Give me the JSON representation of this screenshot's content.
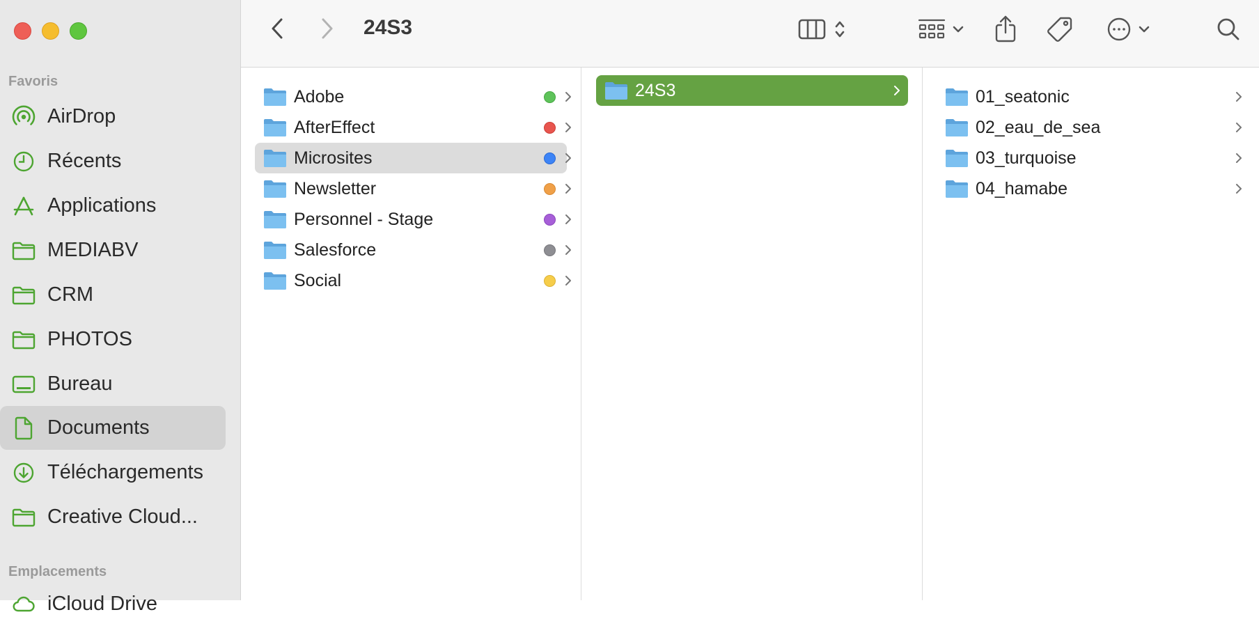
{
  "window": {
    "title": "24S3",
    "traffic_lights": [
      "close",
      "minimize",
      "zoom"
    ]
  },
  "sidebar": {
    "favorites_label": "Favoris",
    "locations_label": "Emplacements",
    "items": [
      {
        "label": "AirDrop",
        "icon": "airdrop-icon"
      },
      {
        "label": "Récents",
        "icon": "clock-icon"
      },
      {
        "label": "Applications",
        "icon": "applications-icon"
      },
      {
        "label": "MEDIABV",
        "icon": "folder-icon"
      },
      {
        "label": "CRM",
        "icon": "folder-icon"
      },
      {
        "label": "PHOTOS",
        "icon": "folder-icon"
      },
      {
        "label": "Bureau",
        "icon": "desktop-icon"
      },
      {
        "label": "Documents",
        "icon": "document-icon",
        "selected": true
      },
      {
        "label": "Téléchargements",
        "icon": "download-icon"
      },
      {
        "label": "Creative Cloud...",
        "icon": "folder-icon"
      }
    ],
    "partial_item": {
      "label": "iCloud Drive",
      "icon": "cloud-icon"
    }
  },
  "toolbar": {
    "back": "chevron-left-icon",
    "forward": "chevron-right-icon",
    "view": "column-view-icon",
    "group": "grid-group-icon",
    "share": "share-icon",
    "tags": "tag-icon",
    "more": "more-icon",
    "search": "search-icon"
  },
  "columns": {
    "first": [
      {
        "name": "Adobe",
        "tag": "#5ec35a"
      },
      {
        "name": "AfterEffect",
        "tag": "#e8554e"
      },
      {
        "name": "Microsites",
        "tag": "#3d84f6",
        "selected": true
      },
      {
        "name": "Newsletter",
        "tag": "#f0a048"
      },
      {
        "name": "Personnel - Stage",
        "tag": "#a75fd8"
      },
      {
        "name": "Salesforce",
        "tag": "#8e8e93"
      },
      {
        "name": "Social",
        "tag": "#f6cd4a"
      }
    ],
    "second": [
      {
        "name": "24S3",
        "selected": true
      }
    ],
    "third": [
      {
        "name": "01_seatonic"
      },
      {
        "name": "02_eau_de_sea"
      },
      {
        "name": "03_turquoise"
      },
      {
        "name": "04_hamabe"
      }
    ]
  },
  "colors": {
    "accent": "#4da531",
    "selection_green": "#65a243",
    "folder": "#6cb4ea"
  }
}
